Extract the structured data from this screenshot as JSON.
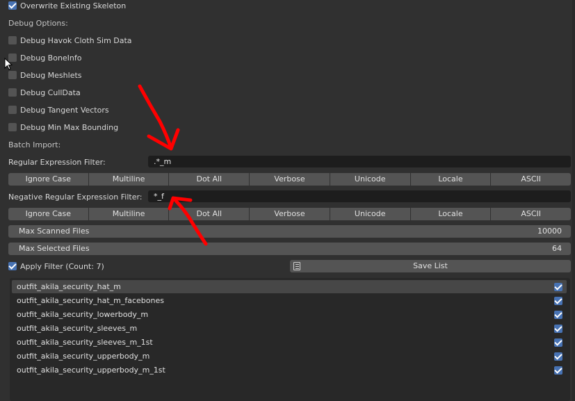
{
  "options": {
    "overwrite_skeleton": {
      "label": "Overwrite Existing Skeleton",
      "checked": true
    },
    "debug_heading": "Debug Options:",
    "debug_items": [
      {
        "label": "Debug Havok Cloth Sim Data",
        "checked": false
      },
      {
        "label": "Debug BoneInfo",
        "checked": false
      },
      {
        "label": "Debug Meshlets",
        "checked": false
      },
      {
        "label": "Debug CullData",
        "checked": false
      },
      {
        "label": "Debug Tangent Vectors",
        "checked": false
      },
      {
        "label": "Debug Min Max Bounding",
        "checked": false
      }
    ],
    "batch_heading": "Batch Import:"
  },
  "regex_filter": {
    "label": "Regular Expression Filter:",
    "value": ".*_m",
    "flags": [
      "Ignore Case",
      "Multiline",
      "Dot All",
      "Verbose",
      "Unicode",
      "Locale",
      "ASCII"
    ]
  },
  "negative_filter": {
    "label": "Negative Regular Expression Filter:",
    "value": "*_f",
    "flags": [
      "Ignore Case",
      "Multiline",
      "Dot All",
      "Verbose",
      "Unicode",
      "Locale",
      "ASCII"
    ]
  },
  "max_scanned": {
    "label": "Max Scanned Files",
    "value": "10000"
  },
  "max_selected": {
    "label": "Max Selected Files",
    "value": "64"
  },
  "apply_filter": {
    "label": "Apply Filter (Count: 7)",
    "checked": true
  },
  "save_list": {
    "label": "Save List",
    "icon": "list-icon"
  },
  "files": [
    {
      "name": "outfit_akila_security_hat_m",
      "checked": true,
      "selected": true
    },
    {
      "name": "outfit_akila_security_hat_m_facebones",
      "checked": true,
      "selected": false
    },
    {
      "name": "outfit_akila_security_lowerbody_m",
      "checked": true,
      "selected": false
    },
    {
      "name": "outfit_akila_security_sleeves_m",
      "checked": true,
      "selected": false
    },
    {
      "name": "outfit_akila_security_sleeves_m_1st",
      "checked": true,
      "selected": false
    },
    {
      "name": "outfit_akila_security_upperbody_m",
      "checked": true,
      "selected": false
    },
    {
      "name": "outfit_akila_security_upperbody_m_1st",
      "checked": true,
      "selected": false
    }
  ],
  "colors": {
    "panel": "#303030",
    "button": "#545454",
    "field": "#1d1d1d",
    "accent": "#4772b3",
    "annotation": "#ff0000"
  }
}
